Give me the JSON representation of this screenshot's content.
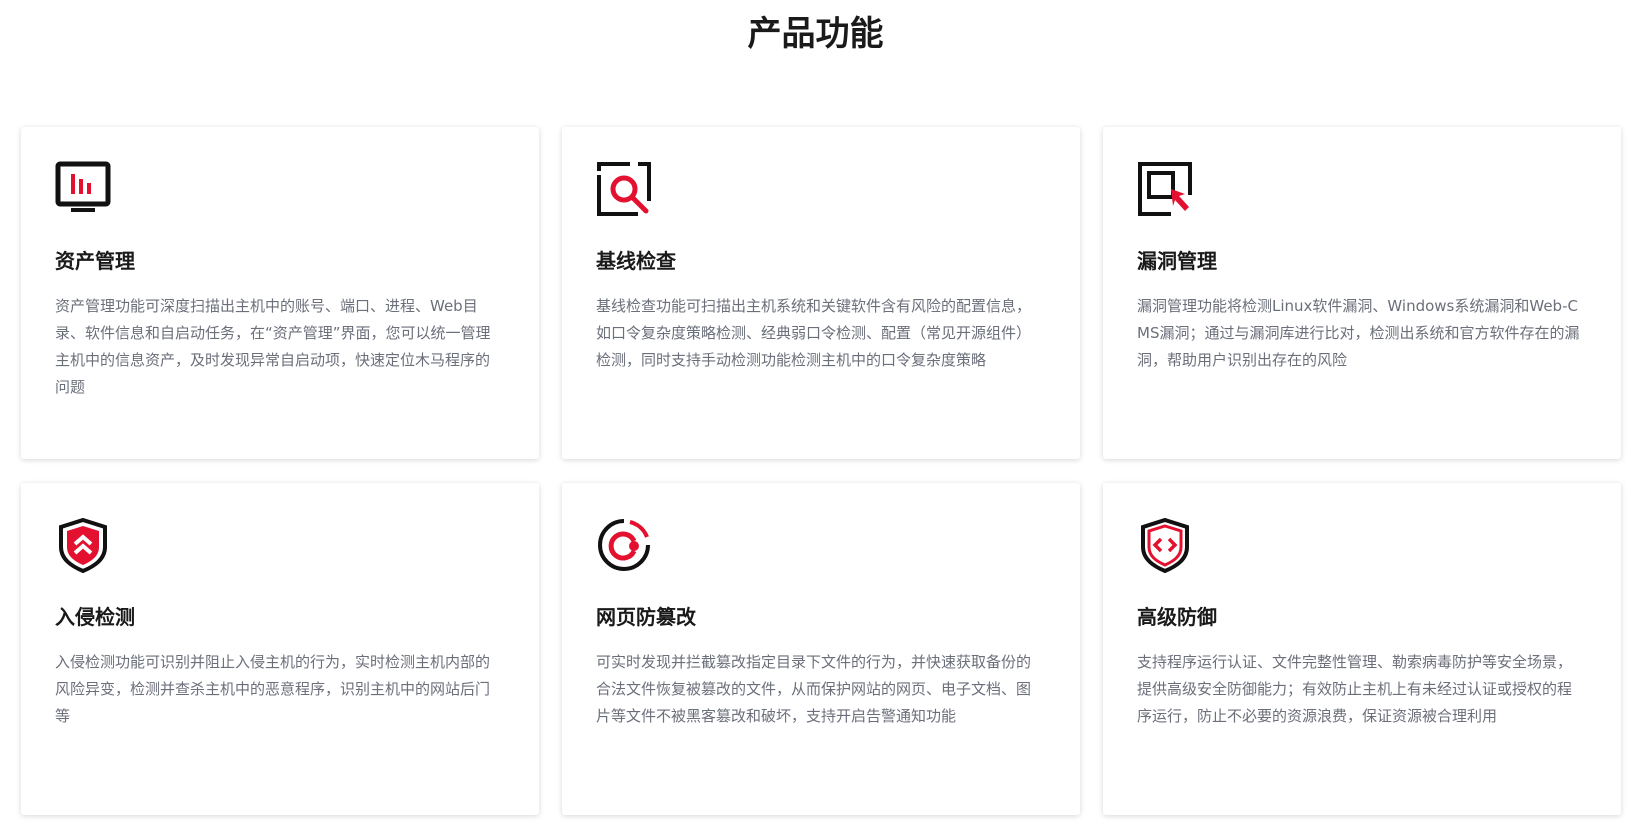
{
  "section": {
    "title": "产品功能"
  },
  "accent_color": "#e3112f",
  "icon_color": "#111111",
  "cards": [
    {
      "icon": "monitor-chart-icon",
      "title": "资产管理",
      "description": "资产管理功能可深度扫描出主机中的账号、端口、进程、Web目录、软件信息和自启动任务，在“资产管理”界面，您可以统一管理主机中的信息资产，及时发现异常自启动项，快速定位木马程序的问题"
    },
    {
      "icon": "magnifier-frame-icon",
      "title": "基线检查",
      "description": "基线检查功能可扫描出主机系统和关键软件含有风险的配置信息，如口令复杂度策略检测、经典弱口令检测、配置（常见开源组件）检测，同时支持手动检测功能检测主机中的口令复杂度策略"
    },
    {
      "icon": "frame-cursor-icon",
      "title": "漏洞管理",
      "description": "漏洞管理功能将检测Linux软件漏洞、Windows系统漏洞和Web-CMS漏洞；通过与漏洞库进行比对，检测出系统和官方软件存在的漏洞，帮助用户识别出存在的风险"
    },
    {
      "icon": "shield-chevron-up-icon",
      "title": "入侵检测",
      "description": "入侵检测功能可识别并阻止入侵主机的行为，实时检测主机内部的风险异变，检测并查杀主机中的恶意程序，识别主机中的网站后门等"
    },
    {
      "icon": "circle-target-icon",
      "title": "网页防篡改",
      "description": "可实时发现并拦截篡改指定目录下文件的行为，并快速获取备份的合法文件恢复被篡改的文件，从而保护网站的网页、电子文档、图片等文件不被黑客篡改和破坏，支持开启告警通知功能"
    },
    {
      "icon": "shield-code-icon",
      "title": "高级防御",
      "description": "支持程序运行认证、文件完整性管理、勒索病毒防护等安全场景，提供高级安全防御能力；有效防止主机上有未经过认证或授权的程序运行，防止不必要的资源浪费，保证资源被合理利用"
    }
  ]
}
